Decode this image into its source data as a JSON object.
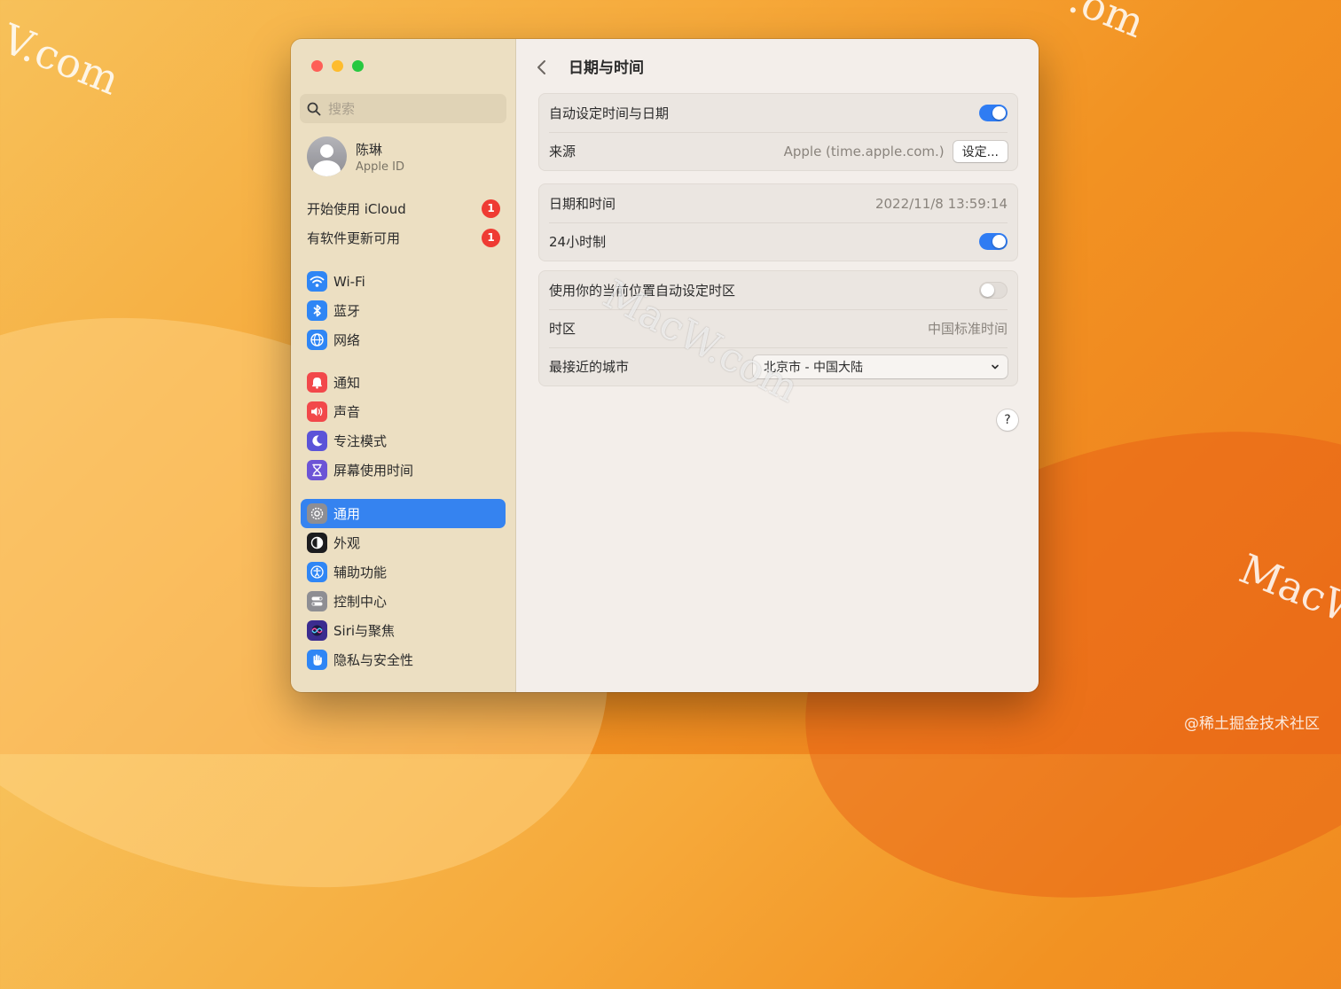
{
  "watermarks": {
    "top_left": "V.com",
    "top_right": ".om",
    "bottom_right": "MacW",
    "window_overlay": "MacW.com"
  },
  "credit": "@稀土掘金技术社区",
  "sidebar": {
    "search_placeholder": "搜索",
    "profile": {
      "name": "陈琳",
      "subtitle": "Apple ID"
    },
    "alerts": [
      {
        "label": "开始使用 iCloud",
        "badge": "1"
      },
      {
        "label": "有软件更新可用",
        "badge": "1"
      }
    ],
    "items": [
      {
        "label": "Wi-Fi",
        "icon": "wifi-icon",
        "color": "#2f86f5"
      },
      {
        "label": "蓝牙",
        "icon": "bluetooth-icon",
        "color": "#2f86f5"
      },
      {
        "label": "网络",
        "icon": "globe-icon",
        "color": "#2f86f5"
      },
      {
        "label": "通知",
        "icon": "bell-icon",
        "color": "#f2484a"
      },
      {
        "label": "声音",
        "icon": "speaker-icon",
        "color": "#f2484a"
      },
      {
        "label": "专注模式",
        "icon": "moon-icon",
        "color": "#5b53d8"
      },
      {
        "label": "屏幕使用时间",
        "icon": "hourglass-icon",
        "color": "#6c54d6"
      },
      {
        "label": "通用",
        "icon": "gear-icon",
        "color": "#8e8e93",
        "active": true
      },
      {
        "label": "外观",
        "icon": "appearance-icon",
        "color": "#1c1c1e"
      },
      {
        "label": "辅助功能",
        "icon": "accessibility-icon",
        "color": "#2f86f5"
      },
      {
        "label": "控制中心",
        "icon": "control-center-icon",
        "color": "#8e8e93"
      },
      {
        "label": "Siri与聚焦",
        "icon": "siri-icon",
        "color": "#3b2c8f"
      },
      {
        "label": "隐私与安全性",
        "icon": "hand-icon",
        "color": "#2f86f5"
      }
    ]
  },
  "main": {
    "title": "日期与时间",
    "auto_time": {
      "label": "自动设定时间与日期",
      "on": true
    },
    "source": {
      "label": "来源",
      "value": "Apple (time.apple.com.)",
      "button": "设定..."
    },
    "datetime": {
      "label": "日期和时间",
      "value": "2022/11/8 13:59:14"
    },
    "clock24": {
      "label": "24小时制",
      "on": true
    },
    "auto_timezone": {
      "label": "使用你的当前位置自动设定时区",
      "on": false
    },
    "timezone": {
      "label": "时区",
      "value": "中国标准时间"
    },
    "closest_city": {
      "label": "最接近的城市",
      "value": "北京市 - 中国大陆"
    },
    "help": "?"
  },
  "colors": {
    "accent": "#3583f0",
    "toggle_on": "#2f7cf3",
    "badge": "#ef3b33"
  }
}
